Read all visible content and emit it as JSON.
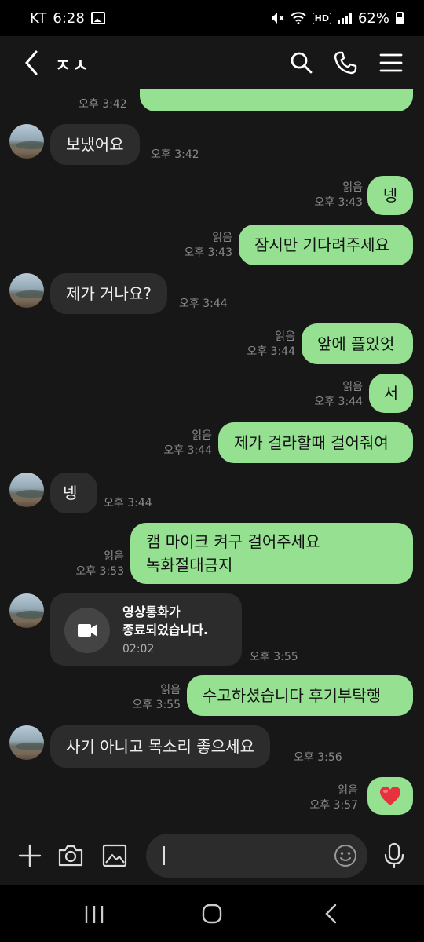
{
  "status": {
    "carrier": "KT",
    "time": "6:28",
    "battery": "62%"
  },
  "header": {
    "title": "ㅈㅅ"
  },
  "messages": {
    "m0": {
      "time": "오후 3:42"
    },
    "m1": {
      "text": "보냈어요",
      "time": "오후 3:42"
    },
    "m2": {
      "text": "넹",
      "read": "읽음",
      "time": "오후 3:43"
    },
    "m3": {
      "text": "잠시만 기다려주세요",
      "read": "읽음",
      "time": "오후 3:43"
    },
    "m4": {
      "text": "제가 거나요?",
      "time": "오후 3:44"
    },
    "m5": {
      "text": "앞에 플있엇",
      "read": "읽음",
      "time": "오후 3:44"
    },
    "m6": {
      "text": "서",
      "read": "읽음",
      "time": "오후 3:44"
    },
    "m7": {
      "text": "제가 걸라할때 걸어줘여",
      "read": "읽음",
      "time": "오후 3:44"
    },
    "m8": {
      "text": "넹",
      "time": "오후 3:44"
    },
    "m9": {
      "line1": "캠 마이크 켜구 걸어주세요",
      "line2": "녹화절대금지",
      "read": "읽음",
      "time": "오후 3:53"
    },
    "m10": {
      "line1": "영상통화가",
      "line2": "종료되었습니다.",
      "duration": "02:02",
      "time": "오후 3:55"
    },
    "m11": {
      "text": "수고하셨습니다 후기부탁행",
      "read": "읽음",
      "time": "오후 3:55"
    },
    "m12": {
      "text": "사기 아니고 목소리 좋으세요",
      "time": "오후 3:56"
    },
    "m13": {
      "emoji": "heart",
      "read": "읽음",
      "time": "오후 3:57"
    }
  },
  "colors": {
    "my_bubble": "#96e191",
    "their_bubble": "#2c2c2c",
    "chat_bg": "#171717",
    "heart": "#e8313f"
  }
}
